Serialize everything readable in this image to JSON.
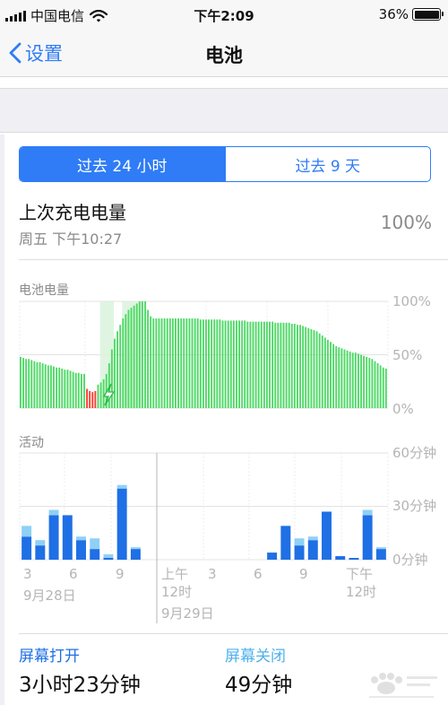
{
  "status_bar": {
    "carrier": "中国电信",
    "time": "下午2:09",
    "battery_percent": "36%"
  },
  "nav": {
    "back_label": "设置",
    "title": "电池"
  },
  "segments": [
    {
      "label": "过去 24 小时",
      "selected": true
    },
    {
      "label": "过去 9 天",
      "selected": false
    }
  ],
  "last_charge": {
    "title": "上次充电电量",
    "time": "周五 下午10:27",
    "value": "100%"
  },
  "battery_chart": {
    "label": "电池电量",
    "y_ticks": [
      "100%",
      "50%",
      "0%"
    ]
  },
  "activity_chart": {
    "label": "活动",
    "y_ticks": [
      "60分钟",
      "30分钟",
      "0分钟"
    ],
    "x_ticks": [
      {
        "top": "3",
        "bottom": ""
      },
      {
        "top": "6",
        "bottom": ""
      },
      {
        "top": "9",
        "bottom": ""
      },
      {
        "top": "上午",
        "bottom": "12时"
      },
      {
        "top": "3",
        "bottom": ""
      },
      {
        "top": "6",
        "bottom": ""
      },
      {
        "top": "9",
        "bottom": ""
      },
      {
        "top": "下午",
        "bottom": "12时"
      }
    ],
    "date_labels": [
      "9月28日",
      "9月29日"
    ]
  },
  "screen": {
    "on_label": "屏幕打开",
    "on_value": "3小时23分钟",
    "off_label": "屏幕关闭",
    "off_value": "49分钟"
  },
  "colors": {
    "accent": "#2f7cf6",
    "green": "#4cd964",
    "red": "#ff3b30",
    "screen_on": "#1f6fe5",
    "screen_off": "#8fd0f6",
    "muted": "#8a8a8e",
    "screen_off_label": "#4fb0ee"
  },
  "chart_data": [
    {
      "type": "bar",
      "title": "电池电量",
      "ylim": [
        0,
        100
      ],
      "y_ticks": [
        "0%",
        "50%",
        "100%"
      ],
      "battery_levels": [
        48,
        47,
        46,
        46,
        45,
        44,
        43,
        43,
        42,
        41,
        40,
        40,
        39,
        38,
        38,
        37,
        36,
        36,
        35,
        34,
        33,
        33,
        32,
        32,
        18,
        16,
        15,
        16,
        22,
        24,
        27,
        32,
        42,
        55,
        65,
        72,
        78,
        84,
        88,
        92,
        94,
        96,
        98,
        100,
        100,
        100,
        92,
        86,
        84,
        84,
        84,
        84,
        84,
        84,
        84,
        84,
        84,
        84,
        84,
        84,
        84,
        84,
        84,
        84,
        84,
        83,
        83,
        83,
        83,
        83,
        83,
        83,
        83,
        82,
        82,
        82,
        82,
        82,
        82,
        82,
        82,
        82,
        81,
        81,
        81,
        81,
        81,
        81,
        81,
        81,
        81,
        81,
        80,
        80,
        80,
        80,
        80,
        80,
        79,
        79,
        78,
        78,
        77,
        76,
        75,
        74,
        73,
        72,
        70,
        68,
        66,
        64,
        62,
        60,
        58,
        57,
        56,
        55,
        54,
        53,
        52,
        52,
        51,
        50,
        49,
        48,
        47,
        46,
        44,
        42,
        40,
        38,
        37
      ],
      "low_power_indices": [
        24,
        25,
        26,
        27
      ],
      "charging_ranges": [
        [
          29,
          33
        ],
        [
          37,
          43
        ]
      ]
    },
    {
      "type": "bar",
      "title": "活动",
      "y_unit": "分钟",
      "ylim": [
        0,
        60
      ],
      "y_ticks": [
        "0分钟",
        "30分钟",
        "60分钟"
      ],
      "series": [
        {
          "name": "屏幕打开",
          "values": [
            13,
            8,
            25,
            25,
            11,
            6,
            1,
            40,
            6,
            0,
            0,
            0,
            0,
            0,
            0,
            0,
            0,
            0,
            4,
            19,
            8,
            11,
            27,
            2,
            1,
            25,
            6
          ]
        },
        {
          "name": "屏幕关闭",
          "values": [
            6,
            3,
            3,
            0,
            2,
            6,
            2,
            2,
            1,
            0,
            0,
            0,
            0,
            0,
            0,
            0,
            0,
            0,
            0,
            0,
            4,
            2,
            0,
            0,
            0,
            3,
            1
          ]
        }
      ]
    }
  ]
}
